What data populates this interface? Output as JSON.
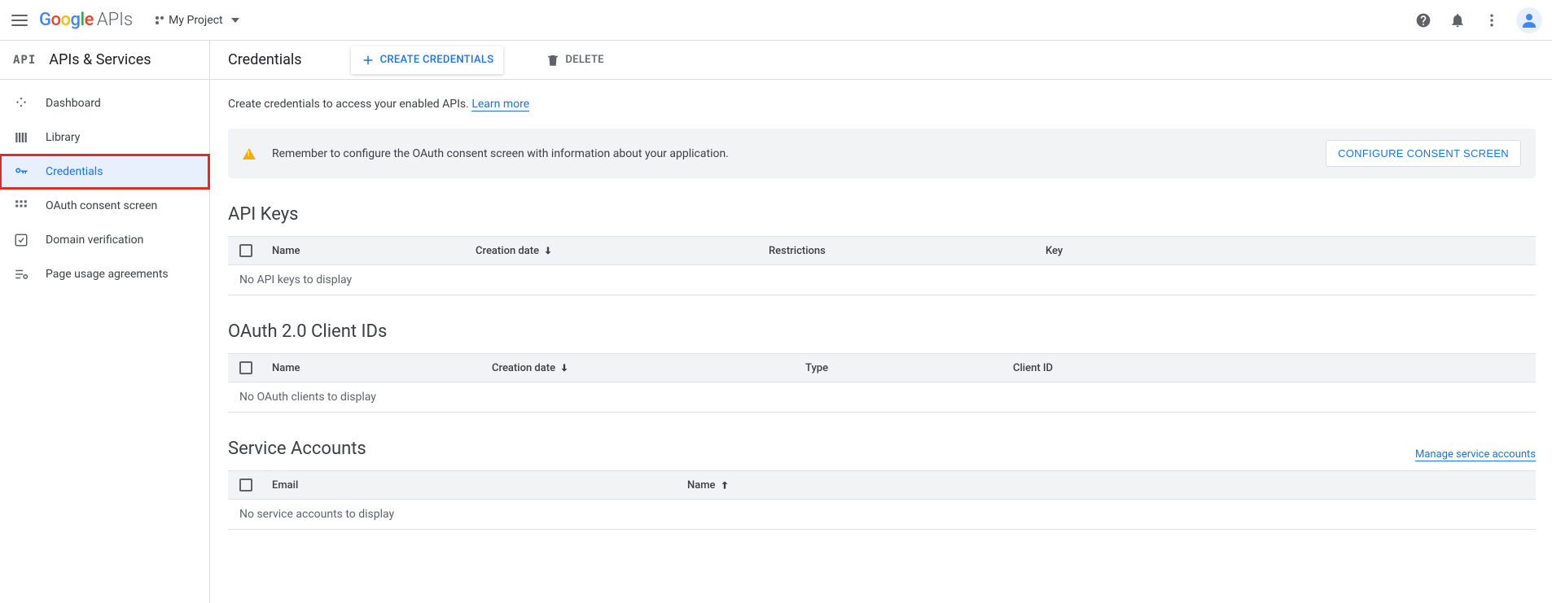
{
  "topbar": {
    "logo_apis": "APIs",
    "project_name": "My Project"
  },
  "sidebar": {
    "api_icon": "API",
    "title": "APIs & Services",
    "items": [
      {
        "label": "Dashboard"
      },
      {
        "label": "Library"
      },
      {
        "label": "Credentials"
      },
      {
        "label": "OAuth consent screen"
      },
      {
        "label": "Domain verification"
      },
      {
        "label": "Page usage agreements"
      }
    ]
  },
  "main": {
    "title": "Credentials",
    "create_btn": "CREATE CREDENTIALS",
    "delete_btn": "DELETE",
    "intro_text": "Create credentials to access your enabled APIs. ",
    "learn_more": "Learn more",
    "banner_text": "Remember to configure the OAuth consent screen with information about your application.",
    "configure_btn": "CONFIGURE CONSENT SCREEN",
    "sections": {
      "api_keys": {
        "title": "API Keys",
        "cols": {
          "name": "Name",
          "created": "Creation date",
          "restrictions": "Restrictions",
          "key": "Key"
        },
        "empty": "No API keys to display"
      },
      "oauth": {
        "title": "OAuth 2.0 Client IDs",
        "cols": {
          "name": "Name",
          "created": "Creation date",
          "type": "Type",
          "clientid": "Client ID"
        },
        "empty": "No OAuth clients to display"
      },
      "service": {
        "title": "Service Accounts",
        "manage": "Manage service accounts",
        "cols": {
          "email": "Email",
          "name": "Name"
        },
        "empty": "No service accounts to display"
      }
    }
  }
}
